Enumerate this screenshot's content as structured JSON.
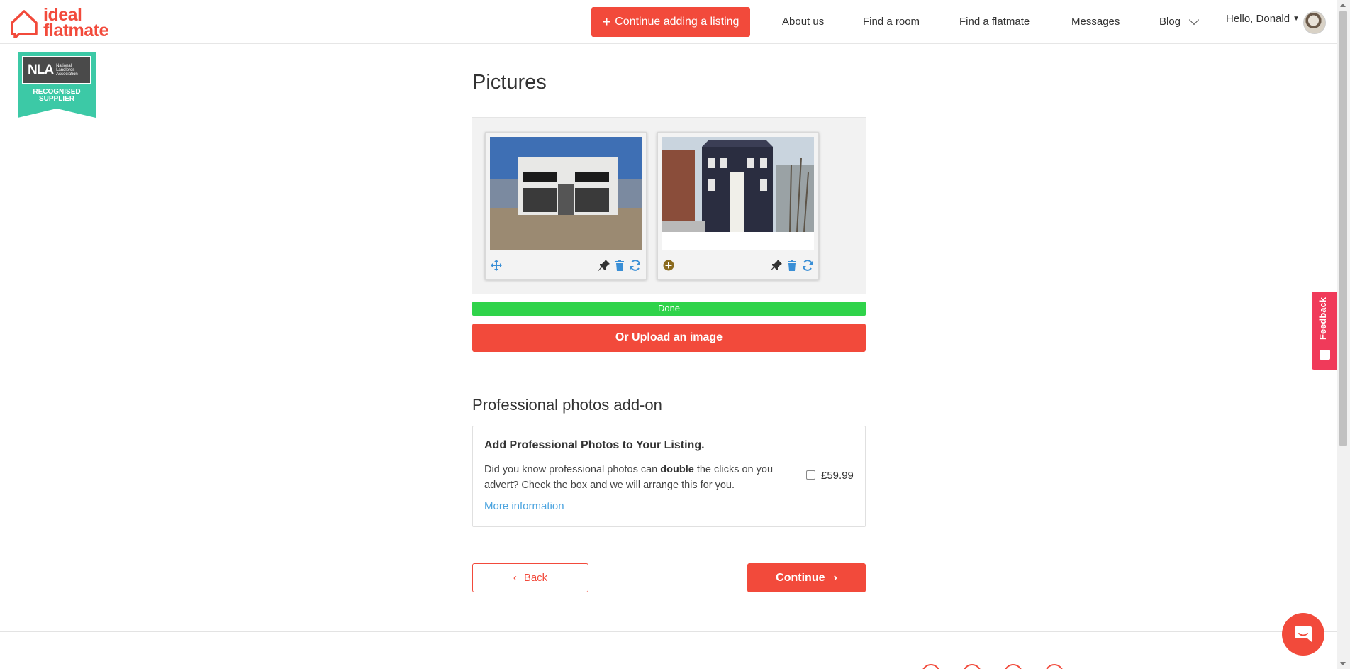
{
  "brand": {
    "name_line1": "ideal",
    "name_line2": "flatmate",
    "accent": "#f24a3b"
  },
  "header": {
    "cta_label": "Continue adding a listing",
    "nav": [
      "About us",
      "Find a room",
      "Find a flatmate",
      "Messages",
      "Blog"
    ],
    "greeting": "Hello, Donald"
  },
  "badge": {
    "abbr": "NLA",
    "org": "National Landlords Association",
    "line1": "RECOGNISED",
    "line2": "SUPPLIER"
  },
  "pictures": {
    "title": "Pictures",
    "cards": [
      {
        "photo": "prada-marfa-photo",
        "left_tool": "move-icon",
        "tools": [
          "pin-icon",
          "trash-icon",
          "rotate-icon"
        ]
      },
      {
        "photo": "townhouse-photo",
        "left_tool": "add-icon",
        "tools": [
          "pin-icon",
          "trash-icon",
          "rotate-icon"
        ]
      }
    ],
    "progress_label": "Done",
    "progress_value": 1.0,
    "upload_label": "Or Upload an image"
  },
  "addon": {
    "section_title": "Professional photos add-on",
    "card_title": "Add Professional Photos to Your Listing.",
    "desc_before": "Did you know professional photos can ",
    "desc_bold": "double",
    "desc_after": " the clicks on you advert? Check the box and we will arrange this for you.",
    "link": "More information",
    "price": "£59.99",
    "checked": false
  },
  "actions": {
    "back": "Back",
    "continue": "Continue"
  },
  "feedback": {
    "label": "Feedback"
  }
}
